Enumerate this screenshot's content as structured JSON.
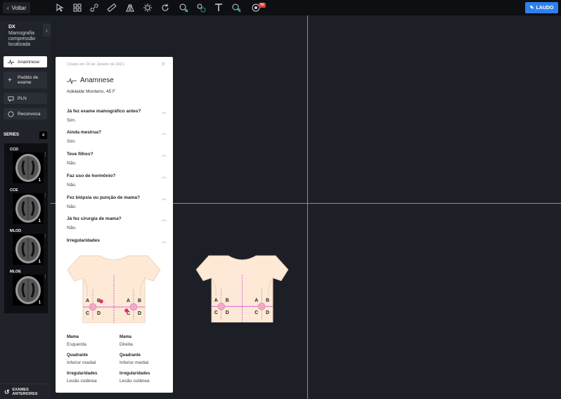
{
  "toolbar": {
    "back_label": "Voltar",
    "laudo_label": "LAUDO",
    "badge": "99",
    "tools": [
      "cursor-icon",
      "grid-icon",
      "link-icon",
      "ruler-icon",
      "flip-icon",
      "brightness-icon",
      "rotate-icon",
      "zoom-icon",
      "measure-icon",
      "text-icon",
      "magnify-icon",
      "record-icon"
    ]
  },
  "sidebar": {
    "modality": "DX",
    "description": "Mamografia compressão localizada",
    "buttons": [
      {
        "label": "Anamnese"
      },
      {
        "label": "Pedido de exame"
      },
      {
        "label": "PLN"
      },
      {
        "label": "Reconvoca"
      }
    ],
    "series_label": "SERIES",
    "series_count": "4",
    "series": [
      {
        "label": "CCD",
        "count": "1"
      },
      {
        "label": "CCE",
        "count": "1"
      },
      {
        "label": "MLOD",
        "count": "1"
      },
      {
        "label": "MLOE",
        "count": "1"
      }
    ],
    "previous_exams": "EXAMES ANTERIORES"
  },
  "panel": {
    "created": "Criado em 10 de Janeiro de 2021",
    "title": "Anamnese",
    "patient": "Adelaide Monteiro, 45 F",
    "questions": [
      {
        "q": "Já fez exame mamográfico antes?",
        "a": "Sim."
      },
      {
        "q": "Ainda mestrua?",
        "a": "Sim."
      },
      {
        "q": "Teve filhos?",
        "a": "Não."
      },
      {
        "q": "Faz uso de hormônio?",
        "a": "Não."
      },
      {
        "q": "Fez biópsia ou punção de mama?",
        "a": "Não."
      },
      {
        "q": "Já fez cirurgia de mama?",
        "a": "Não."
      },
      {
        "q": "Irregularidades",
        "a": ""
      }
    ],
    "quadrant_letters": [
      "A",
      "B",
      "C",
      "D"
    ],
    "findings": [
      {
        "mama_label": "Mama",
        "mama": "Esquerda",
        "quadrante_label": "Quadrante",
        "quadrante": "Inferior medial",
        "irreg_label": "Irregularidades",
        "irreg": "Lesão cutânea"
      },
      {
        "mama_label": "Mama",
        "mama": "Direita",
        "quadrante_label": "Quadrante",
        "quadrante": "Inferior medial",
        "irreg_label": "Irregularidades",
        "irreg": "Lesão cutânea"
      }
    ]
  },
  "colors": {
    "accent": "#2f80ed",
    "skin": "#fde9d6",
    "marker": "#e0306a",
    "guide": "#d63ad6"
  }
}
